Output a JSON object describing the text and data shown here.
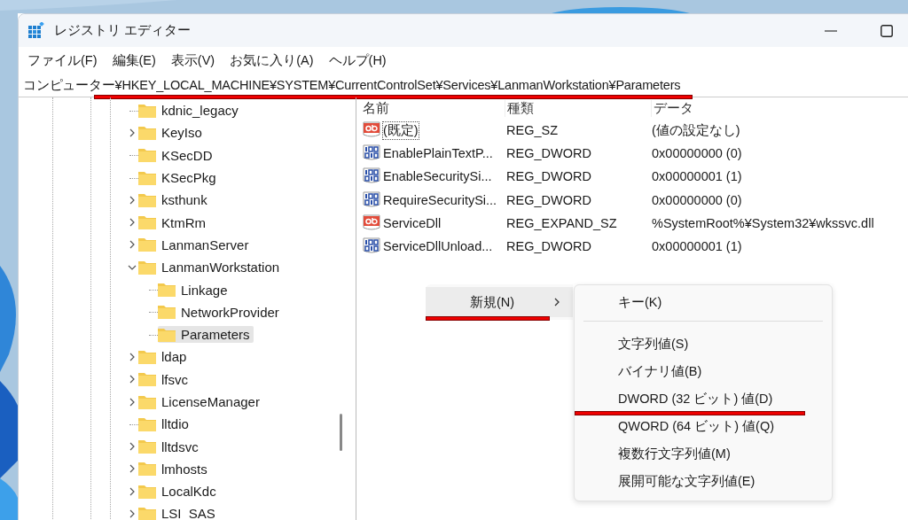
{
  "window": {
    "title": "レジストリ エディター"
  },
  "menu_bar": [
    "ファイル(F)",
    "編集(E)",
    "表示(V)",
    "お気に入り(A)",
    "ヘルプ(H)"
  ],
  "address_bar": {
    "value": "コンピューター¥HKEY_LOCAL_MACHINE¥SYSTEM¥CurrentControlSet¥Services¥LanmanWorkstation¥Parameters",
    "underlined": true
  },
  "tree": [
    {
      "label": "kdnic_legacy",
      "kind": "leaf",
      "selected": false
    },
    {
      "label": "KeyIso",
      "kind": "node",
      "expanded": false,
      "selected": false
    },
    {
      "label": "KSecDD",
      "kind": "leaf",
      "selected": false
    },
    {
      "label": "KSecPkg",
      "kind": "leaf",
      "selected": false
    },
    {
      "label": "ksthunk",
      "kind": "node",
      "expanded": false,
      "selected": false
    },
    {
      "label": "KtmRm",
      "kind": "node",
      "expanded": false,
      "selected": false
    },
    {
      "label": "LanmanServer",
      "kind": "node",
      "expanded": false,
      "selected": false
    },
    {
      "label": "LanmanWorkstation",
      "kind": "node",
      "expanded": true,
      "selected": false,
      "children": [
        {
          "label": "Linkage",
          "kind": "leaf",
          "selected": false
        },
        {
          "label": "NetworkProvider",
          "kind": "leaf",
          "selected": false
        },
        {
          "label": "Parameters",
          "kind": "leaf",
          "selected": true
        }
      ]
    },
    {
      "label": "ldap",
      "kind": "node",
      "expanded": false,
      "selected": false
    },
    {
      "label": "lfsvc",
      "kind": "node",
      "expanded": false,
      "selected": false
    },
    {
      "label": "LicenseManager",
      "kind": "node",
      "expanded": false,
      "selected": false
    },
    {
      "label": "lltdio",
      "kind": "leaf",
      "selected": false
    },
    {
      "label": "lltdsvc",
      "kind": "node",
      "expanded": false,
      "selected": false
    },
    {
      "label": "lmhosts",
      "kind": "node",
      "expanded": false,
      "selected": false
    },
    {
      "label": "LocalKdc",
      "kind": "node",
      "expanded": false,
      "selected": false
    },
    {
      "label": "LSI_SAS",
      "kind": "node",
      "expanded": false,
      "selected": false
    }
  ],
  "values_table": {
    "columns": [
      "名前",
      "種類",
      "データ"
    ],
    "rows": [
      {
        "kind": "string",
        "name": "(既定)",
        "type": "REG_SZ",
        "data": "(値の設定なし)",
        "focused": true
      },
      {
        "kind": "binary",
        "name": "EnablePlainTextP...",
        "type": "REG_DWORD",
        "data": "0x00000000 (0)",
        "focused": false
      },
      {
        "kind": "binary",
        "name": "EnableSecuritySi...",
        "type": "REG_DWORD",
        "data": "0x00000001 (1)",
        "focused": false
      },
      {
        "kind": "binary",
        "name": "RequireSecuritySi...",
        "type": "REG_DWORD",
        "data": "0x00000000 (0)",
        "focused": false
      },
      {
        "kind": "string",
        "name": "ServiceDll",
        "type": "REG_EXPAND_SZ",
        "data": "%SystemRoot%¥System32¥wkssvc.dll",
        "focused": false
      },
      {
        "kind": "binary",
        "name": "ServiceDllUnload...",
        "type": "REG_DWORD",
        "data": "0x00000001 (1)",
        "focused": false
      }
    ]
  },
  "context_menu": {
    "items": [
      {
        "label": "新規(N)",
        "has_submenu": true,
        "underlined": true
      }
    ]
  },
  "submenu": {
    "items": [
      {
        "kind": "item",
        "label": "キー(K)",
        "underlined": false
      },
      {
        "kind": "separator"
      },
      {
        "kind": "item",
        "label": "文字列値(S)",
        "underlined": false
      },
      {
        "kind": "item",
        "label": "バイナリ値(B)",
        "underlined": false
      },
      {
        "kind": "item",
        "label": "DWORD (32 ビット) 値(D)",
        "underlined": true
      },
      {
        "kind": "item",
        "label": "QWORD (64 ビット) 値(Q)",
        "underlined": false
      },
      {
        "kind": "item",
        "label": "複数行文字列値(M)",
        "underlined": false
      },
      {
        "kind": "item",
        "label": "展開可能な文字列値(E)",
        "underlined": false
      }
    ]
  }
}
